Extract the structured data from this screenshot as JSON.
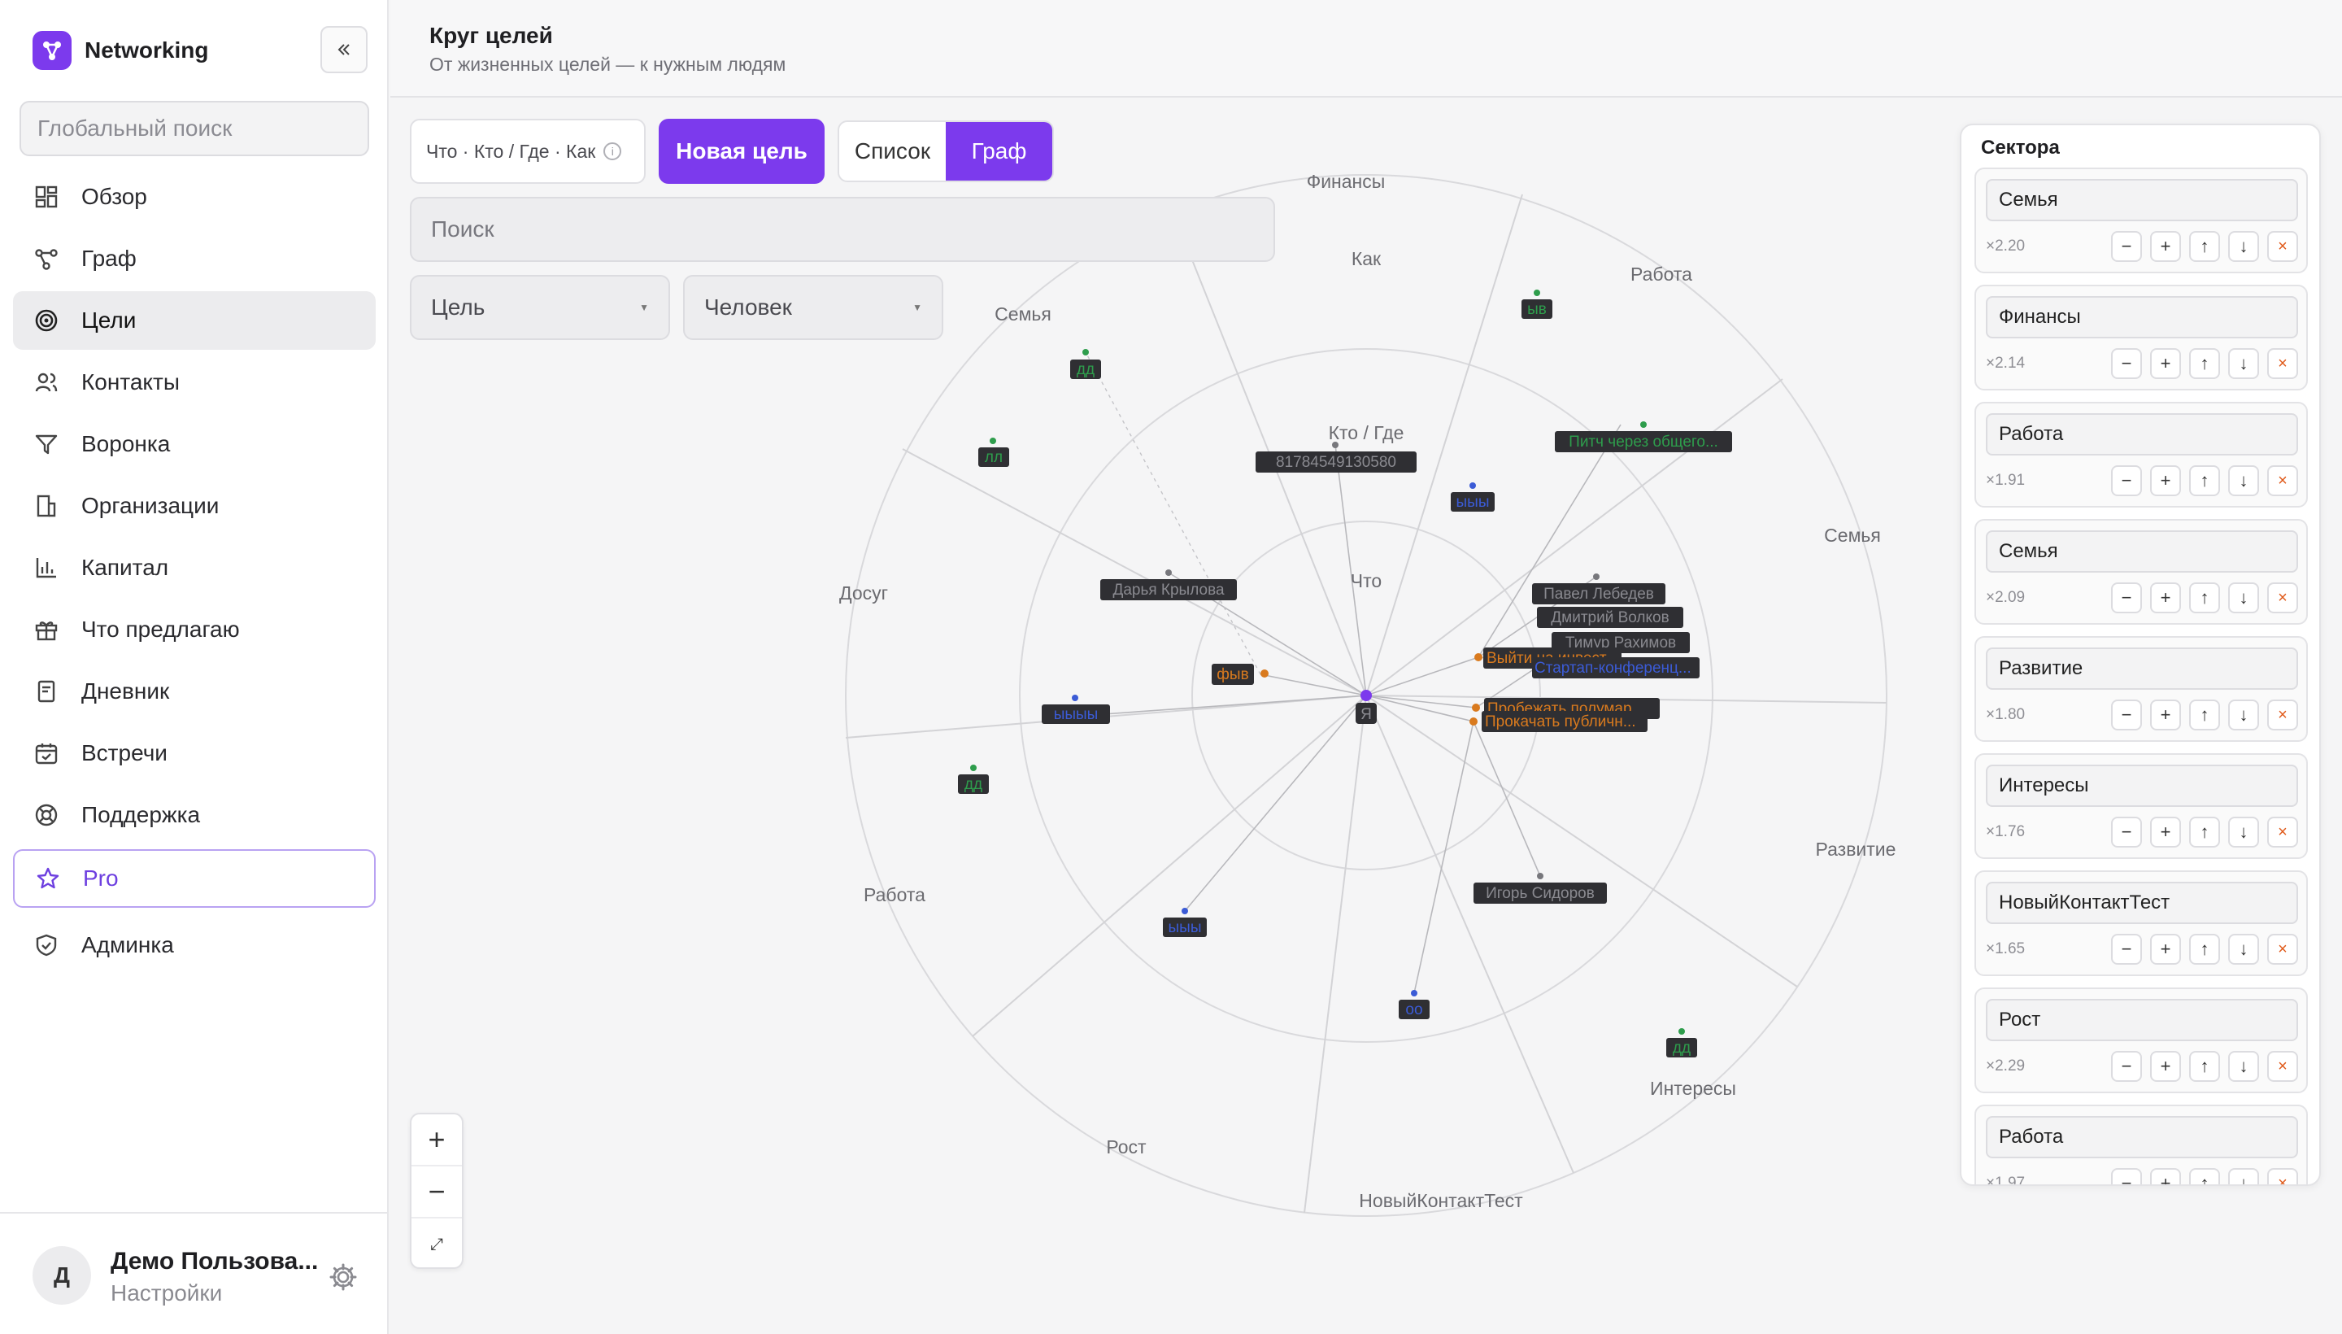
{
  "app": {
    "name": "Networking"
  },
  "search": {
    "placeholder": "Глобальный поиск"
  },
  "nav": {
    "overview": "Обзор",
    "graph": "Граф",
    "goals": "Цели",
    "contacts": "Контакты",
    "funnel": "Воронка",
    "orgs": "Организации",
    "capital": "Капитал",
    "offers": "Что предлагаю",
    "diary": "Дневник",
    "meetings": "Встречи",
    "support": "Поддержка",
    "pro": "Pro",
    "admin": "Админка"
  },
  "user": {
    "initial": "Д",
    "name": "Демо Пользова...",
    "settings": "Настройки"
  },
  "header": {
    "title": "Круг целей",
    "subtitle": "От жизненных целей — к нужным людям"
  },
  "toolbar": {
    "hint": "Что · Кто / Где · Как",
    "info": "i",
    "new_goal": "Новая цель",
    "view_list": "Список",
    "view_graph": "Граф",
    "search_placeholder": "Поиск",
    "goal_filter": "Цель",
    "person_filter": "Человек"
  },
  "zoom": {
    "plus": "+",
    "minus": "−",
    "fit": "⤢"
  },
  "graph": {
    "rings": {
      "what": "Что",
      "who_where": "Кто / Где",
      "how": "Как"
    },
    "sector_labels": {
      "finance": "Финансы",
      "work_top": "Работа",
      "family_right": "Семья",
      "development": "Развитие",
      "interests": "Интересы",
      "new_contact": "НовыйКонтактТест",
      "growth": "Рост",
      "work_left": "Работа",
      "leisure": "Досуг",
      "family_left": "Семья"
    },
    "center": "Я",
    "nodes": {
      "dd1": "дд",
      "ll": "лл",
      "yv": "ыв",
      "pitch": "Питч через общего...",
      "phone": "81784549130580",
      "yyy1": "ыыы",
      "darya": "Дарья Крылова",
      "pavel": "Павел Лебедев",
      "dmitry": "Дмитрий Волков",
      "timur": "Тимур Рахимов",
      "exit": "Выйти на инвест...",
      "startup": "Стартап-конференц...",
      "fyv": "фыв",
      "yyyyy": "ыыыы",
      "halfmar": "Пробежать полумар...",
      "public": "Прокачать публичн...",
      "dd2": "дд",
      "igor": "Игорь Сидоров",
      "yyy2": "ыыы",
      "oo": "оо",
      "dd3": "дд"
    },
    "colors": {
      "green": "#2e9d4c",
      "blue": "#3b5bd6",
      "orange": "#d97a1e",
      "purple": "#7c3aed",
      "gray": "#77777c"
    }
  },
  "sectors": {
    "title": "Сектора",
    "items": [
      {
        "name": "Семья",
        "weight": "×2.20"
      },
      {
        "name": "Финансы",
        "weight": "×2.14"
      },
      {
        "name": "Работа",
        "weight": "×1.91"
      },
      {
        "name": "Семья",
        "weight": "×2.09"
      },
      {
        "name": "Развитие",
        "weight": "×1.80"
      },
      {
        "name": "Интересы",
        "weight": "×1.76"
      },
      {
        "name": "НовыйКонтактТест",
        "weight": "×1.65"
      },
      {
        "name": "Рост",
        "weight": "×2.29"
      },
      {
        "name": "Работа",
        "weight": "×1.97"
      }
    ],
    "buttons": {
      "minus": "−",
      "plus": "+",
      "up": "↑",
      "down": "↓",
      "delete": "×"
    }
  }
}
